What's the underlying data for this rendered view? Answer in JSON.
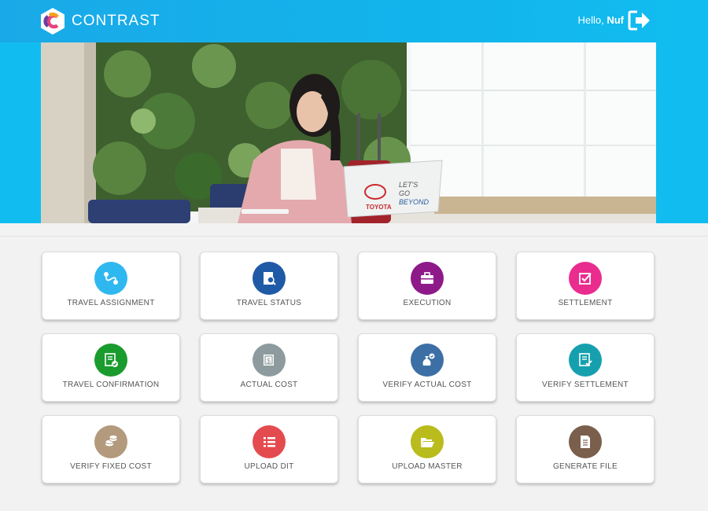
{
  "header": {
    "brand": "CONTRAST",
    "greeting_prefix": "Hello, ",
    "user_name": "Nuf",
    "logo_icon": "contrast-hexagon-logo",
    "logout_icon": "logout-arrow-icon",
    "bar_color": "#12b4ec"
  },
  "hero": {
    "laptop_logo_brand": "TOYOTA",
    "laptop_slogan_1": "LET'S",
    "laptop_slogan_2": "GO",
    "laptop_slogan_3": "BEYOND"
  },
  "menu": [
    {
      "label": "TRAVEL ASSIGNMENT",
      "icon": "route-icon",
      "color": "#2fb8f0"
    },
    {
      "label": "TRAVEL STATUS",
      "icon": "document-search-icon",
      "color": "#1f5aa6"
    },
    {
      "label": "EXECUTION",
      "icon": "briefcase-icon",
      "color": "#8e1a8a"
    },
    {
      "label": "SETTLEMENT",
      "icon": "checkbox-icon",
      "color": "#ea2c8f"
    },
    {
      "label": "TRAVEL CONFIRMATION",
      "icon": "checklist-document-icon",
      "color": "#1a9b2e"
    },
    {
      "label": "ACTUAL COST",
      "icon": "money-icon",
      "color": "#8d9b9e"
    },
    {
      "label": "VERIFY ACTUAL COST",
      "icon": "money-bag-check-icon",
      "color": "#3c6fa5"
    },
    {
      "label": "VERIFY SETTLEMENT",
      "icon": "document-check-icon",
      "color": "#16a0ae"
    },
    {
      "label": "VERIFY FIXED COST",
      "icon": "coins-icon",
      "color": "#b39a7d"
    },
    {
      "label": "UPLOAD DIT",
      "icon": "list-icon",
      "color": "#e44b4f"
    },
    {
      "label": "UPLOAD MASTER",
      "icon": "folder-open-icon",
      "color": "#b9bc1c"
    },
    {
      "label": "GENERATE FILE",
      "icon": "file-icon",
      "color": "#7a5f4c"
    }
  ]
}
